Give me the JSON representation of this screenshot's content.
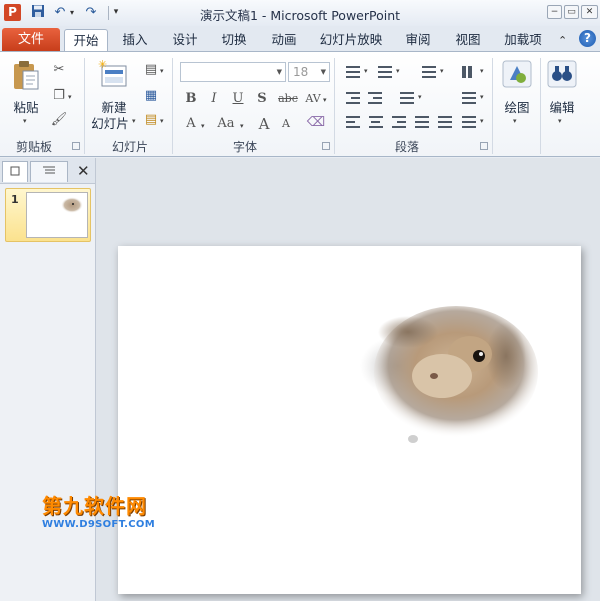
{
  "window": {
    "title": "演示文稿1 - Microsoft PowerPoint",
    "app_logo": "P",
    "qat": {
      "save": "save-icon",
      "undo": "↶",
      "redo": "↷",
      "customize": "▾"
    },
    "controls": {
      "minimize": "−",
      "restore": "▭",
      "close": "✕"
    }
  },
  "ribbon_tabs": {
    "file": "文件",
    "items": [
      "开始",
      "插入",
      "设计",
      "切换",
      "动画",
      "幻灯片放映",
      "审阅",
      "视图",
      "加载项"
    ],
    "active_index": 0,
    "help": "?"
  },
  "clipboard": {
    "paste": "粘贴",
    "group": "剪贴板"
  },
  "slides": {
    "new_slide_line1": "新建",
    "new_slide_line2": "幻灯片",
    "group": "幻灯片"
  },
  "font": {
    "font_name": "",
    "font_size": "18",
    "group": "字体",
    "buttons": [
      "B",
      "I",
      "U",
      "S",
      "abc",
      "AV",
      "A",
      "Aa",
      "A",
      "A"
    ]
  },
  "paragraph": {
    "group": "段落"
  },
  "drawing": {
    "label": "绘图"
  },
  "editing": {
    "label": "编辑"
  },
  "left_panel": {
    "slide_number": "1",
    "close": "✕"
  },
  "watermark": {
    "title": "第九软件网",
    "url": "WWW.D9SOFT.COM"
  },
  "colors": {
    "file_tab": "#d24726",
    "accent": "#2f7fe0",
    "thumb_selected": "#fbe28e"
  }
}
